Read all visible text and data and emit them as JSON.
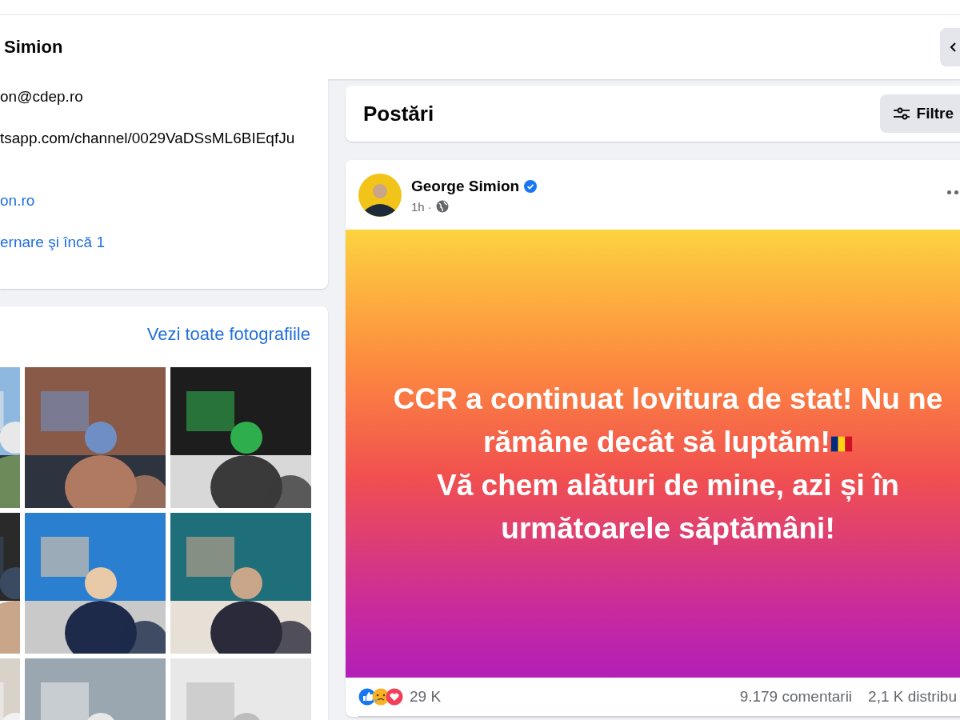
{
  "header": {
    "title": "Simion"
  },
  "intro": {
    "items": [
      {
        "kind": "text",
        "text": "on@cdep.ro"
      },
      {
        "kind": "text",
        "text": "tsapp.com/channel/0029VaDSsML6BIEqfJu"
      },
      {
        "kind": "link",
        "text": "on.ro"
      },
      {
        "kind": "link",
        "text": "ernare şi încă 1"
      }
    ]
  },
  "photos": {
    "see_all": "Vezi toate fotografiile"
  },
  "posts_header": {
    "title": "Postări",
    "filter_button": "Filtre"
  },
  "post": {
    "author": "George Simion",
    "verified": true,
    "time": "1h ·",
    "lines": [
      "CCR a continuat lovitura de stat! Nu ne rămâne decât să luptăm!",
      "Vă chem alături de mine, azi și în următoarele săptămâni!"
    ],
    "reactions": "29 K",
    "comments": "9.179 comentarii",
    "shares": "2,1 K distribu"
  }
}
